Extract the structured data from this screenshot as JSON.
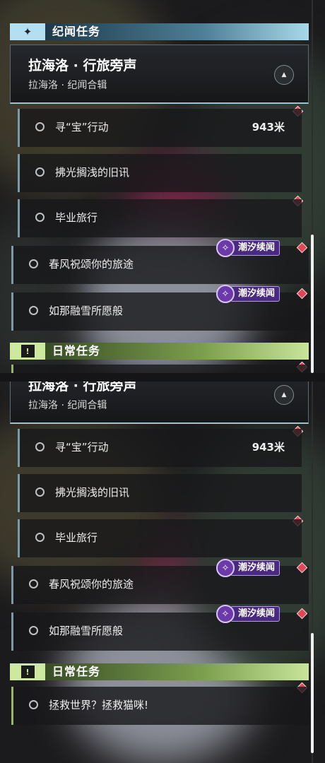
{
  "story_section": {
    "title": "纪闻任务",
    "icon": "sparkle-icon"
  },
  "daily_section": {
    "title": "日常任务",
    "icon": "exclamation-icon"
  },
  "chapter": {
    "title": "拉海洛 · 行旅旁声",
    "subtitle": "拉海洛 · 纪闻合辑",
    "toggle_icon": "collapse-arrow-icon"
  },
  "quests": {
    "q1": {
      "name": "寻“宝”行动",
      "distance": "943米"
    },
    "q2": {
      "name": "拂光搁浅的旧讯"
    },
    "q3": {
      "name": "毕业旅行"
    },
    "q4": {
      "name": "春风祝颂你的旅途",
      "badge": "潮汐续闻"
    },
    "q5": {
      "name": "如那融雪所愿般",
      "badge": "潮汐续闻"
    }
  },
  "daily_quests": {
    "d1": {
      "name": "拯救世界？拯救猫咪!"
    }
  },
  "colors": {
    "story_accent": "#b4dff0",
    "daily_accent": "#cde99f",
    "marker": "#e04656",
    "badge": "#6c3aa8"
  }
}
